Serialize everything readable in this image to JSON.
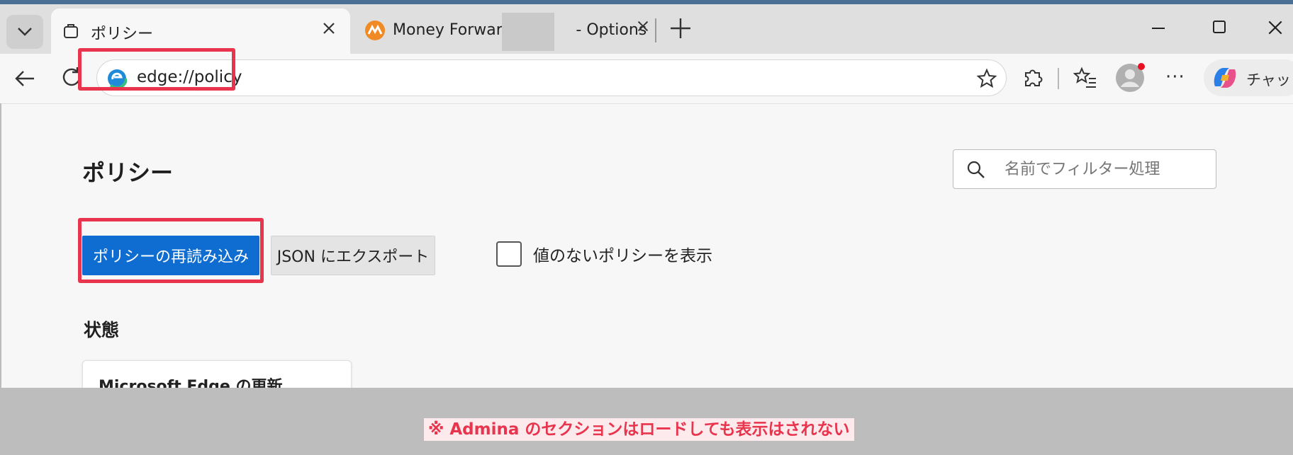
{
  "browser": {
    "tabs": [
      {
        "title": "ポリシー",
        "active": true
      },
      {
        "title_prefix": "Money Forward",
        "title_suffix": "- Options",
        "active": false
      }
    ],
    "address": "edge://policy",
    "copilot_label": "チャット",
    "more_label": "···"
  },
  "page": {
    "title": "ポリシー",
    "filter_placeholder": "名前でフィルター処理",
    "reload_button": "ポリシーの再読み込み",
    "export_button": "JSON にエクスポート",
    "show_empty_label": "値のないポリシーを表示",
    "show_empty_checked": false,
    "status_heading": "状態",
    "status_card_title": "Microsoft Edge の更新"
  },
  "annotation": {
    "note": "※ Admina のセクションはロードしても表示はされない",
    "highlight_color": "#e8344c"
  },
  "colors": {
    "primary_button": "#0f6cd0",
    "accent_red": "#e8344c"
  }
}
